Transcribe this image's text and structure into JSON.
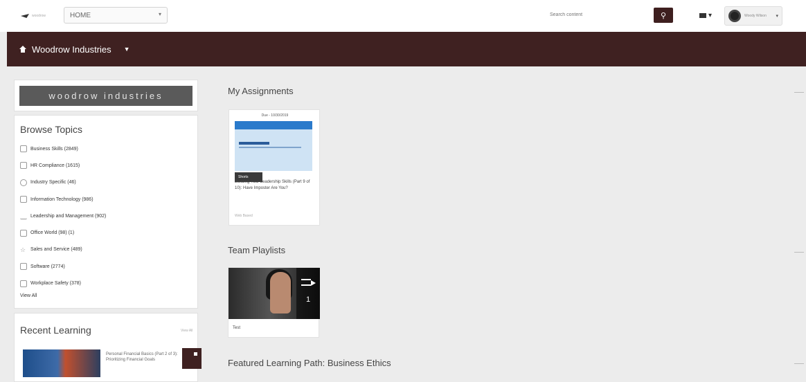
{
  "header": {
    "logo_text": "woodrow",
    "nav_select": "HOME",
    "search_placeholder": "Search content",
    "user_name": "Woody Wilson",
    "icons": {
      "search": "search-icon",
      "mail": "envelope-icon",
      "caret": "chevron-down-icon"
    }
  },
  "brand": {
    "org_name": "Woodrow Industries",
    "icon": "home-icon"
  },
  "colors": {
    "brand": "#3f2121",
    "accent_link": "#2a7acb"
  },
  "sidebar": {
    "logo_text": "woodrow industries",
    "browse_title": "Browse Topics",
    "topics": [
      {
        "label": "Business Skills (2849)",
        "icon": "briefcase-icon"
      },
      {
        "label": "HR Compliance (1615)",
        "icon": "people-icon"
      },
      {
        "label": "Industry Specific (46)",
        "icon": "globe-icon"
      },
      {
        "label": "Information Technology (986)",
        "icon": "monitor-icon"
      },
      {
        "label": "Leadership and Management (902)",
        "icon": "chart-icon"
      },
      {
        "label": "Office World (98) (1)",
        "icon": "folder-icon"
      },
      {
        "label": "Sales and Service (489)",
        "icon": "star-icon"
      },
      {
        "label": "Software (2774)",
        "icon": "laptop-icon"
      },
      {
        "label": "Workplace Safety (378)",
        "icon": "shield-icon"
      }
    ],
    "view_all": "View All",
    "recent_title": "Recent Learning",
    "recent_view_all": "View All",
    "recent_item_title": "Personal Financial Basics (Part 2 of 3): Prioritizing Financial Goals"
  },
  "main": {
    "assignments_title": "My Assignments",
    "assignment": {
      "due": "Due - 10/30/2019",
      "badge": "Shorts",
      "title": "Building Your Leadership Skills (Part 9 of 10): Have Imposter Are You?",
      "meta": "Web Based"
    },
    "playlists_title": "Team Playlists",
    "playlist": {
      "count": "1",
      "name": "Test"
    },
    "featured_title": "Featured Learning Path: Business Ethics"
  }
}
